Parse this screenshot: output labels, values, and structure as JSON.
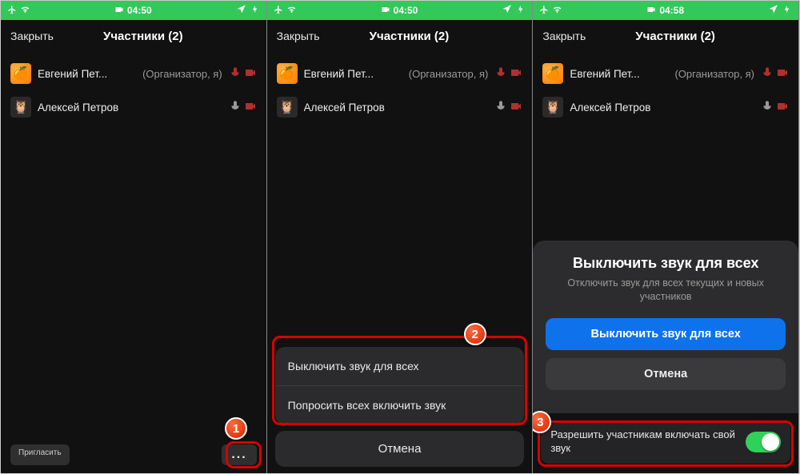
{
  "status": {
    "time1": "04:50",
    "time2": "04:50",
    "time3": "04:58"
  },
  "nav": {
    "close": "Закрыть",
    "title": "Участники (2)"
  },
  "participants": [
    {
      "name": "Евгений Пет...",
      "role": "(Организатор, я)"
    },
    {
      "name": "Алексей Петров",
      "role": ""
    }
  ],
  "bottom": {
    "invite": "Пригласить",
    "more": "..."
  },
  "sheet": {
    "mute_all": "Выключить звук для всех",
    "ask_unmute": "Попросить всех включить звук",
    "cancel": "Отмена"
  },
  "modal": {
    "title": "Выключить звук для всех",
    "subtitle": "Отключить звук для всех текущих и новых участников",
    "confirm": "Выключить звук для всех",
    "cancel": "Отмена"
  },
  "toggle": {
    "label": "Разрешить участникам включать свой звук"
  },
  "badges": {
    "b1": "1",
    "b2": "2",
    "b3": "3"
  }
}
